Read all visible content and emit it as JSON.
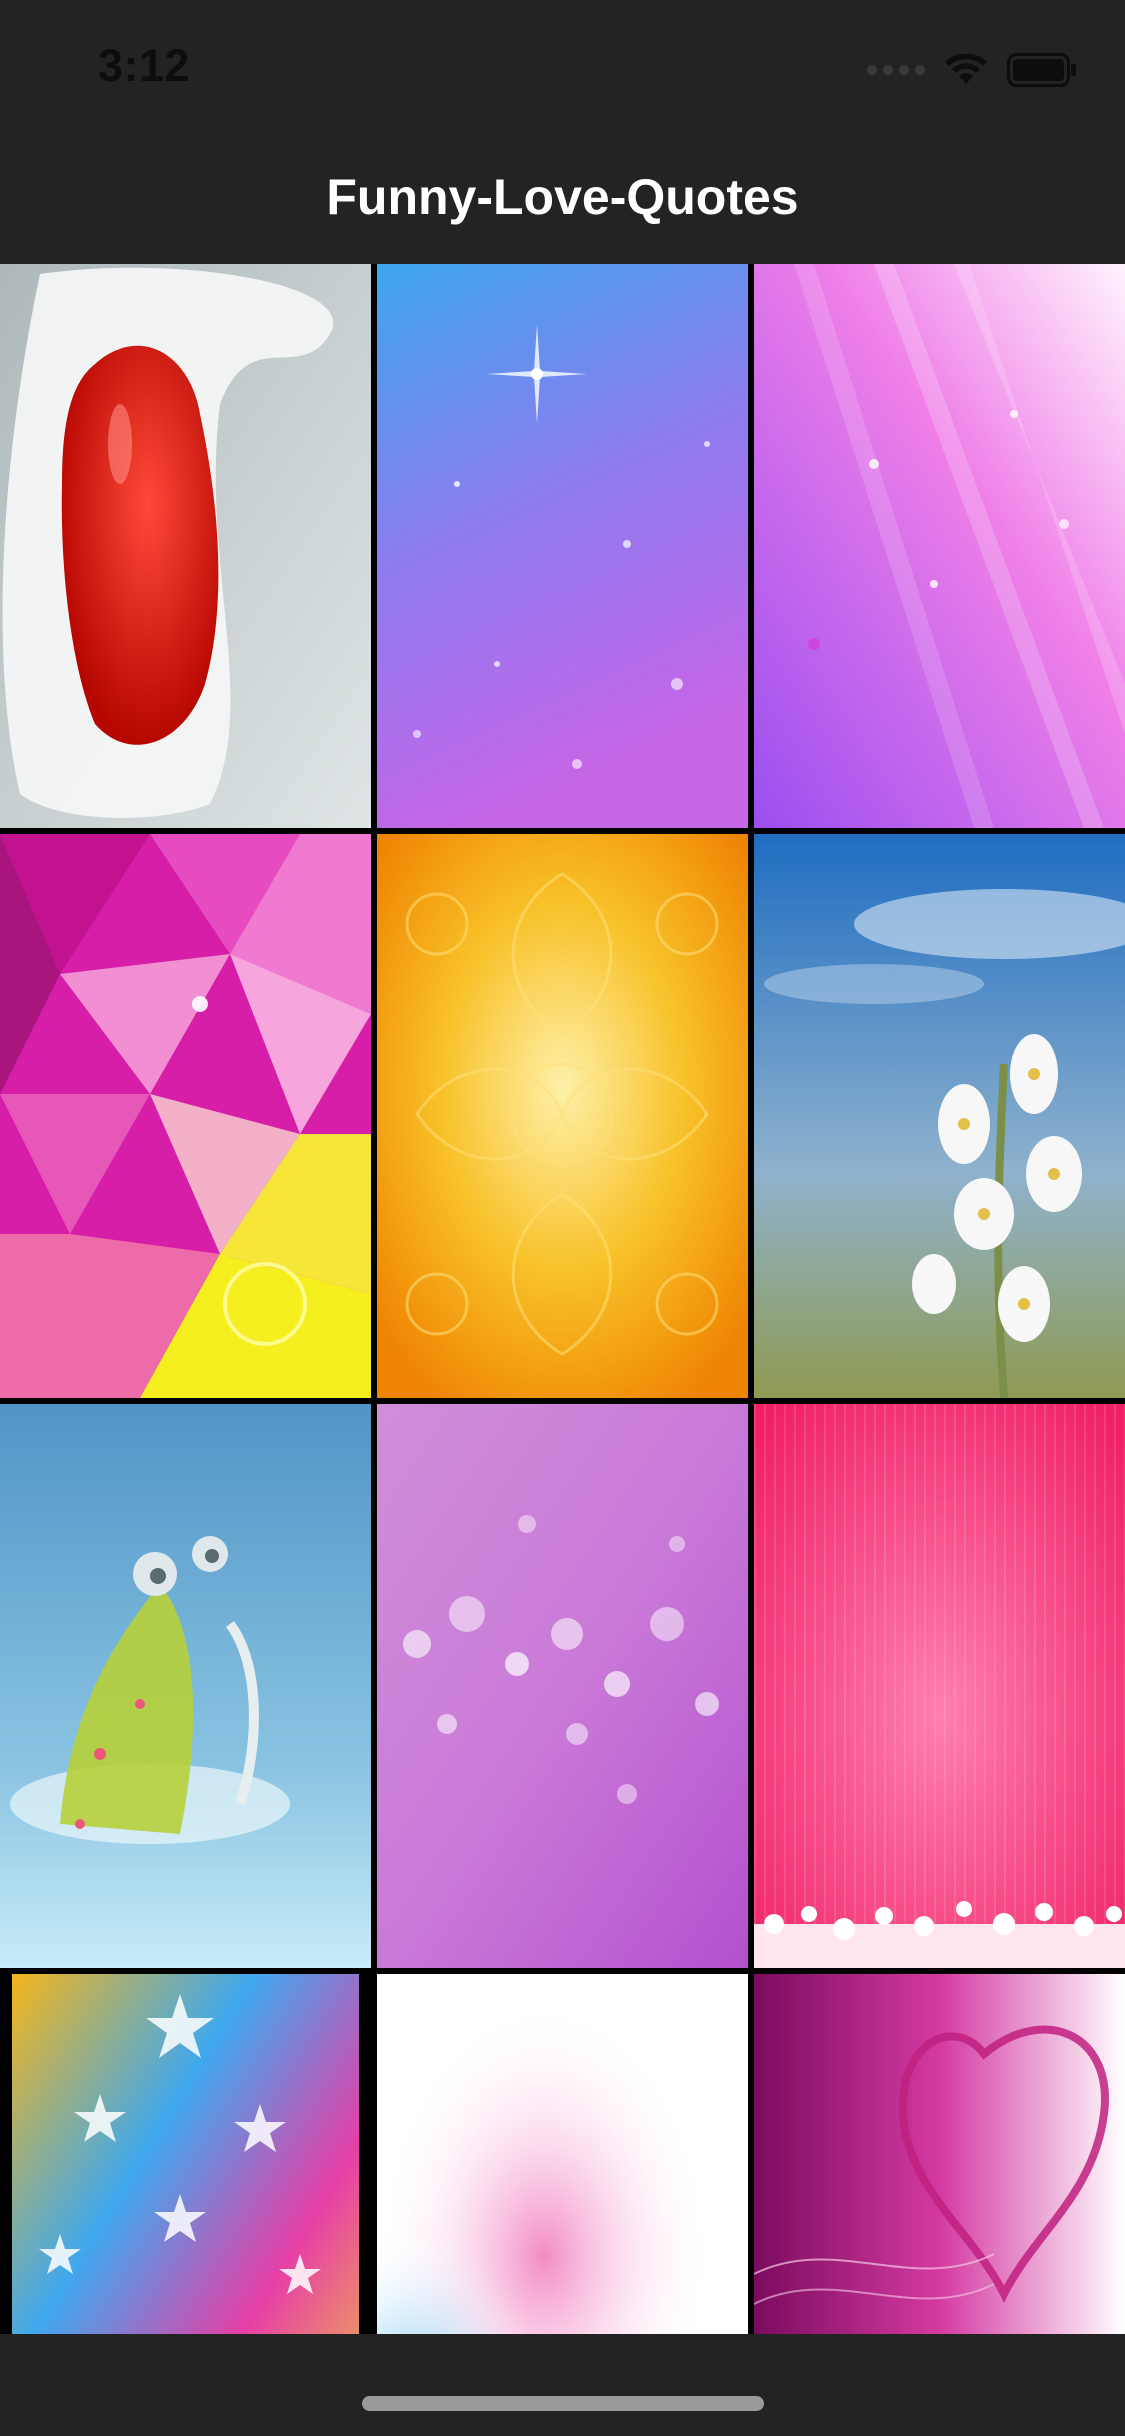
{
  "status_bar": {
    "time": "3:12",
    "icons": [
      "signal-dots-icon",
      "wifi-icon",
      "battery-icon"
    ]
  },
  "nav": {
    "title": "Funny-Love-Quotes"
  },
  "grid": {
    "columns": 3,
    "tiles": [
      {
        "name": "tile-red-heart-feather",
        "theme": "red heart on white feather",
        "colors": [
          "#c9d2d3",
          "#d40f0a",
          "#ffffff"
        ]
      },
      {
        "name": "tile-blue-purple-sparkle",
        "theme": "blue to purple sparkle",
        "colors": [
          "#4fb3f0",
          "#8b5cf0",
          "#c56ee8"
        ]
      },
      {
        "name": "tile-pink-violet-streaks",
        "theme": "pink violet light streaks",
        "colors": [
          "#b061f2",
          "#f28ae8",
          "#fde0fb"
        ]
      },
      {
        "name": "tile-pink-yellow-geometric",
        "theme": "pink and yellow polygons",
        "colors": [
          "#d11fa6",
          "#f070c0",
          "#f7f01a"
        ]
      },
      {
        "name": "tile-orange-ornament",
        "theme": "orange damask pattern",
        "colors": [
          "#f08a05",
          "#f7c21c",
          "#fde59a"
        ]
      },
      {
        "name": "tile-white-flowers-sky",
        "theme": "white flowers under blue sky",
        "colors": [
          "#2f78c4",
          "#9fb6c9",
          "#f4f4f4"
        ]
      },
      {
        "name": "tile-green-creature",
        "theme": "green creature on blue",
        "colors": [
          "#5d9fca",
          "#bfe4f2",
          "#b4cf40"
        ]
      },
      {
        "name": "tile-purple-bokeh",
        "theme": "purple bokeh lights",
        "colors": [
          "#c57ad8",
          "#d99be4",
          "#ffffff"
        ]
      },
      {
        "name": "tile-pink-stripes-hearts",
        "theme": "pink stripes with hearts",
        "colors": [
          "#f0246c",
          "#ff6fa4",
          "#ffffff"
        ]
      },
      {
        "name": "tile-rainbow-stars",
        "theme": "rainbow stars",
        "colors": [
          "#f7c51a",
          "#3aa8f0",
          "#e83aa3"
        ]
      },
      {
        "name": "tile-pink-blue-soft",
        "theme": "soft pink blue blur",
        "colors": [
          "#ffffff",
          "#f6a6d3",
          "#48b4f0"
        ]
      },
      {
        "name": "tile-magenta-heart-outline",
        "theme": "magenta with heart outline",
        "colors": [
          "#8a0f6a",
          "#d1399f",
          "#ffffff"
        ]
      }
    ]
  },
  "colors": {
    "bar_background": "#232323",
    "grid_gap": "#000000",
    "title_text": "#ffffff",
    "home_indicator": "#9a9a9a"
  }
}
